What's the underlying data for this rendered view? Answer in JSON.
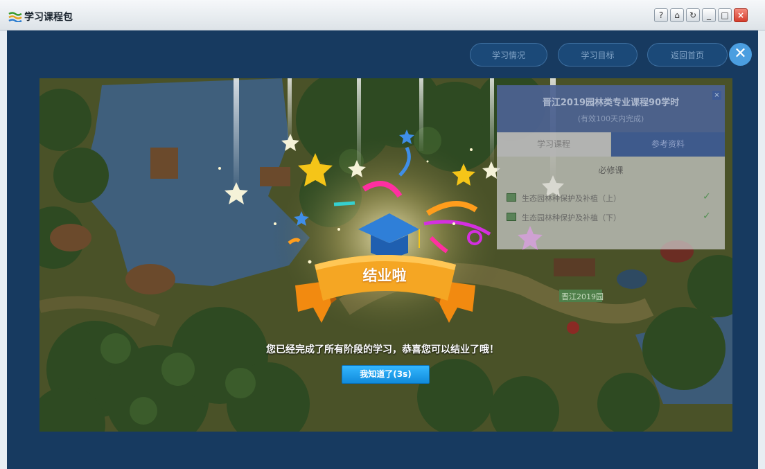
{
  "window": {
    "title": "学习课程包",
    "buttons": {
      "help": "?",
      "home": "⌂",
      "refresh": "↻",
      "minimize": "_",
      "maximize": "□",
      "close": "×"
    }
  },
  "nav": {
    "items": [
      "学习情况",
      "学习目标",
      "返回首页"
    ],
    "close_icon": "✕"
  },
  "course_panel": {
    "title": "晋江2019园林类专业课程90学时",
    "subtitle": "(有效100天内完成)",
    "close": "×",
    "tabs": [
      "学习课程",
      "参考资料"
    ],
    "section_label": "必修课",
    "courses": [
      {
        "name": "生态园林种保护及补植（上）",
        "done": true,
        "check": "✓"
      },
      {
        "name": "生态园林种保护及补植（下）",
        "done": true,
        "check": "✓"
      }
    ]
  },
  "map": {
    "sign_label": "晋江2019园"
  },
  "celebration": {
    "banner_text": "结业啦",
    "message": "您已经完成了所有阶段的学习，恭喜您可以结业了哦！",
    "button_label": "我知道了(3s)"
  },
  "colors": {
    "app_background": "#173a60",
    "button_blue": "#1aa0f0",
    "banner_orange": "#f5a623",
    "panel_header": "#284482"
  }
}
